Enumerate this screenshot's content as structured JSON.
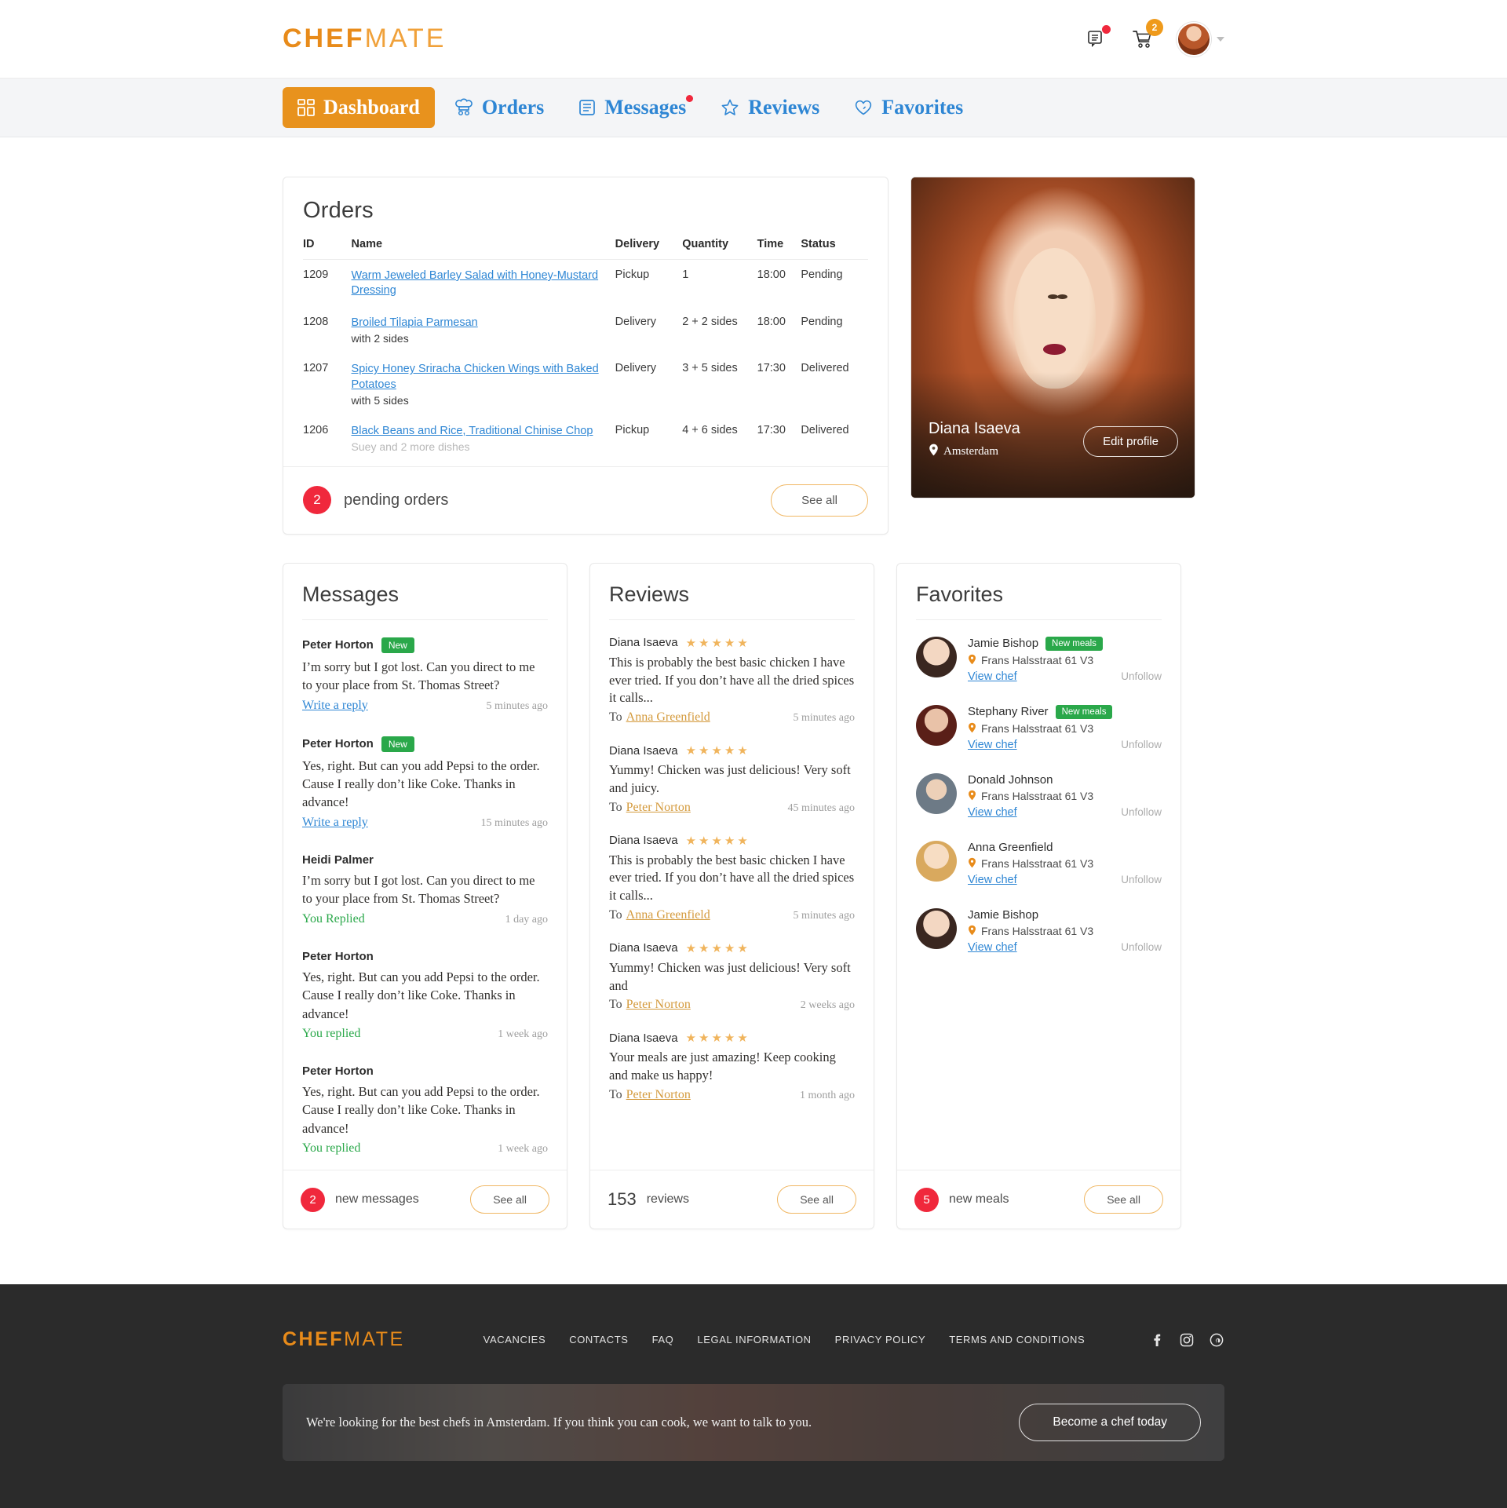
{
  "brand": {
    "strong": "CHEF",
    "light": "MATE"
  },
  "header": {
    "messages_icon": "chat-icon",
    "cart_icon": "cart-icon",
    "cart_badge": "2",
    "avatar": "user-avatar",
    "caret": "chevron-down-icon"
  },
  "nav": {
    "items": [
      {
        "label": "Dashboard",
        "icon": "grid-icon",
        "active": true,
        "dot": false
      },
      {
        "label": "Orders",
        "icon": "chef-hat-icon",
        "active": false,
        "dot": false
      },
      {
        "label": "Messages",
        "icon": "message-lines-icon",
        "active": false,
        "dot": true
      },
      {
        "label": "Reviews",
        "icon": "star-icon",
        "active": false,
        "dot": false
      },
      {
        "label": "Favorites",
        "icon": "heart-icon",
        "active": false,
        "dot": false
      }
    ]
  },
  "orders": {
    "title": "Orders",
    "columns": [
      "ID",
      "Name",
      "Delivery",
      "Quantity",
      "Time",
      "Status"
    ],
    "rows": [
      {
        "id": "1209",
        "name": "Warm Jeweled Barley Salad with Honey-Mustard Dressing",
        "sub": "",
        "sub_muted": "",
        "delivery": "Pickup",
        "quantity": "1",
        "time": "18:00",
        "status": "Pending",
        "status_kind": "pending"
      },
      {
        "id": "1208",
        "name": "Broiled Tilapia Parmesan",
        "sub": "with 2 sides",
        "sub_muted": "",
        "delivery": "Delivery",
        "quantity": "2 + 2 sides",
        "time": "18:00",
        "status": "Pending",
        "status_kind": "pending"
      },
      {
        "id": "1207",
        "name": "Spicy Honey Sriracha Chicken Wings with Baked Potatoes",
        "sub": "with 5 sides",
        "sub_muted": "",
        "delivery": "Delivery",
        "quantity": "3 + 5 sides",
        "time": "17:30",
        "status": "Delivered",
        "status_kind": "delivered"
      },
      {
        "id": "1206",
        "name": "Black Beans and Rice, Traditional Chinise Chop",
        "sub": "Suey",
        "sub_muted": "and 2 more dishes",
        "delivery": "Pickup",
        "quantity": "4 + 6 sides",
        "time": "17:30",
        "status": "Delivered",
        "status_kind": "delivered"
      }
    ],
    "footer_count": "2",
    "footer_label": "pending orders",
    "see_all": "See all"
  },
  "profile": {
    "name": "Diana Isaeva",
    "location_icon": "map-pin-icon",
    "location": "Amsterdam",
    "edit_button": "Edit profile"
  },
  "messages": {
    "title": "Messages",
    "items": [
      {
        "name": "Peter Horton",
        "tag": "New",
        "body": "I’m sorry but I got lost. Can you direct to me to your place from St. Thomas Street?",
        "action": "Write a reply",
        "action_kind": "link",
        "time": "5 minutes ago"
      },
      {
        "name": "Peter Horton",
        "tag": "New",
        "body": "Yes, right. But can you add Pepsi to the order. Cause I really don’t like Coke. Thanks in advance!",
        "action": "Write a reply",
        "action_kind": "link",
        "time": "15 minutes ago"
      },
      {
        "name": "Heidi Palmer",
        "tag": "",
        "body": "I’m sorry but I got lost. Can you direct to me to your place from St. Thomas Street?",
        "action": "You Replied",
        "action_kind": "replied",
        "time": "1 day ago"
      },
      {
        "name": "Peter Horton",
        "tag": "",
        "body": "Yes, right. But can you add Pepsi to the order. Cause I really don’t like Coke. Thanks in advance!",
        "action": "You replied",
        "action_kind": "replied",
        "time": "1 week ago"
      },
      {
        "name": "Peter Horton",
        "tag": "",
        "body": "Yes, right. But can you add Pepsi to the order. Cause I really don’t like Coke. Thanks in advance!",
        "action": "You replied",
        "action_kind": "replied",
        "time": "1 week ago"
      }
    ],
    "footer_count": "2",
    "footer_label": "new messages",
    "see_all": "See all"
  },
  "reviews": {
    "title": "Reviews",
    "items": [
      {
        "name": "Diana Isaeva",
        "stars": 5,
        "body": "This is probably the best basic chicken I have ever tried. If you don’t have all the dried spices it calls...",
        "to_label": "To",
        "to_name": "Anna Greenfield",
        "time": "5 minutes ago"
      },
      {
        "name": "Diana Isaeva",
        "stars": 5,
        "body": "Yummy! Chicken was just delicious! Very soft and juicy.",
        "to_label": "To",
        "to_name": "Peter Norton",
        "time": "45 minutes ago"
      },
      {
        "name": "Diana Isaeva",
        "stars": 5,
        "body": "This is probably the best basic chicken I have ever tried. If you don’t have all the dried spices it calls...",
        "to_label": "To",
        "to_name": "Anna Greenfield",
        "time": "5 minutes ago"
      },
      {
        "name": "Diana Isaeva",
        "stars": 5,
        "body": "Yummy! Chicken was just delicious! Very soft and",
        "to_label": "To",
        "to_name": "Peter Norton",
        "time": "2 weeks ago"
      },
      {
        "name": "Diana Isaeva",
        "stars": 5,
        "body": "Your meals are just amazing! Keep cooking and make us happy!",
        "to_label": "To",
        "to_name": "Peter Norton",
        "time": "1 month ago"
      }
    ],
    "footer_count": "153",
    "footer_label": "reviews",
    "see_all": "See all"
  },
  "favorites": {
    "title": "Favorites",
    "items": [
      {
        "name": "Jamie Bishop",
        "tag": "New meals",
        "address": "Frans Halsstraat 61 V3",
        "link": "View chef",
        "unfollow": "Unfollow",
        "avatar": "avatar-brunette"
      },
      {
        "name": "Stephany River",
        "tag": "New meals",
        "address": "Frans Halsstraat 61 V3",
        "link": "View chef",
        "unfollow": "Unfollow",
        "avatar": "avatar-dark-red"
      },
      {
        "name": "Donald Johnson",
        "tag": "",
        "address": "Frans Halsstraat 61 V3",
        "link": "View chef",
        "unfollow": "Unfollow",
        "avatar": "avatar-man"
      },
      {
        "name": "Anna Greenfield",
        "tag": "",
        "address": "Frans Halsstraat 61 V3",
        "link": "View chef",
        "unfollow": "Unfollow",
        "avatar": "avatar-blonde"
      },
      {
        "name": "Jamie Bishop",
        "tag": "",
        "address": "Frans Halsstraat 61 V3",
        "link": "View chef",
        "unfollow": "Unfollow",
        "avatar": "avatar-brunette"
      }
    ],
    "footer_count": "5",
    "footer_label": "new meals",
    "see_all": "See all"
  },
  "footer": {
    "links": [
      "VACANCIES",
      "CONTACTS",
      "FAQ",
      "LEGAL INFORMATION",
      "PRIVACY POLICY",
      "TERMS AND CONDITIONS"
    ],
    "socials": [
      "facebook-icon",
      "instagram-icon",
      "pinterest-icon"
    ],
    "cta_text": "We're looking for the best chefs in Amsterdam. If you think you can cook, we want to talk to you.",
    "cta_button": "Become a chef today"
  },
  "colors": {
    "brand_orange": "#e88b1a",
    "nav_blue": "#2e86d4",
    "red": "#f0283c",
    "green": "#2aa84a",
    "amber": "#f0b45c"
  }
}
